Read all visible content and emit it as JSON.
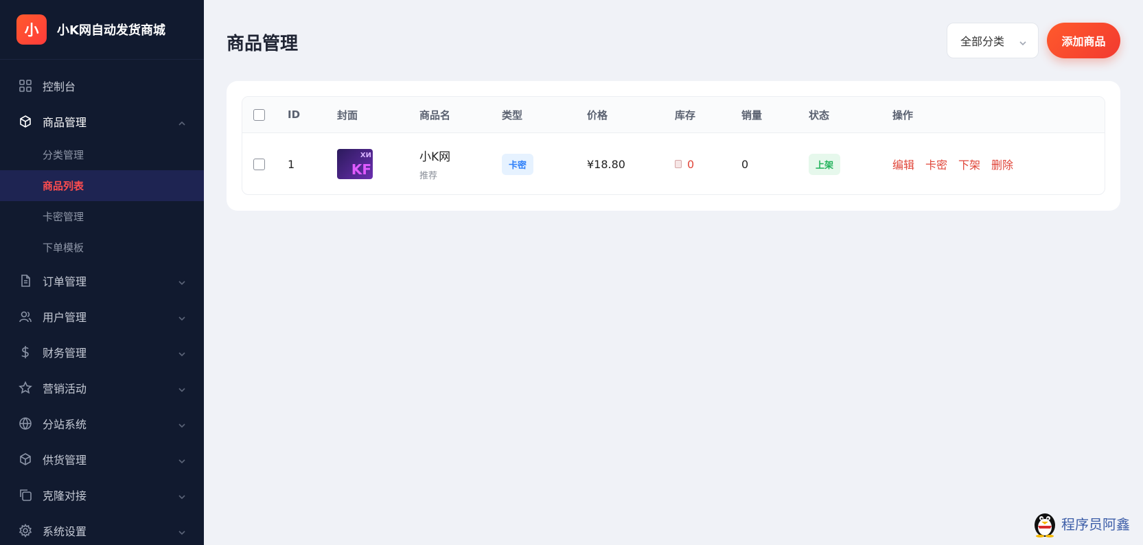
{
  "brand": {
    "logo_char": "小",
    "name": "小K网自动发货商城"
  },
  "sidebar": {
    "items": [
      {
        "label": "控制台",
        "icon": "dashboard-icon"
      },
      {
        "label": "商品管理",
        "icon": "box-icon",
        "open": true,
        "children": [
          "分类管理",
          "商品列表",
          "卡密管理",
          "下单模板"
        ],
        "active_child": "商品列表"
      },
      {
        "label": "订单管理",
        "icon": "document-icon"
      },
      {
        "label": "用户管理",
        "icon": "users-icon"
      },
      {
        "label": "财务管理",
        "icon": "dollar-icon"
      },
      {
        "label": "营销活动",
        "icon": "star-icon"
      },
      {
        "label": "分站系统",
        "icon": "globe-icon"
      },
      {
        "label": "供货管理",
        "icon": "package-icon"
      },
      {
        "label": "克隆对接",
        "icon": "copy-icon"
      },
      {
        "label": "系统设置",
        "icon": "gear-icon"
      }
    ]
  },
  "header": {
    "title": "商品管理",
    "category_select": "全部分类",
    "add_button": "添加商品"
  },
  "table": {
    "columns": [
      "ID",
      "封面",
      "商品名",
      "类型",
      "价格",
      "库存",
      "销量",
      "状态",
      "操作"
    ],
    "rows": [
      {
        "id": "1",
        "cover_text_top": "ХИ",
        "cover_text_bottom": "KF",
        "name": "小K网",
        "subtitle": "推荐",
        "type": "卡密",
        "price": "¥18.80",
        "stock": "0",
        "sales": "0",
        "status": "上架",
        "actions": [
          "编辑",
          "卡密",
          "下架",
          "删除"
        ]
      }
    ]
  },
  "watermark": "程序员阿鑫",
  "colors": {
    "accent": "#ff4d4f",
    "sidebar_bg": "#111a2f",
    "brand_gradient_start": "#ff5a2c"
  }
}
